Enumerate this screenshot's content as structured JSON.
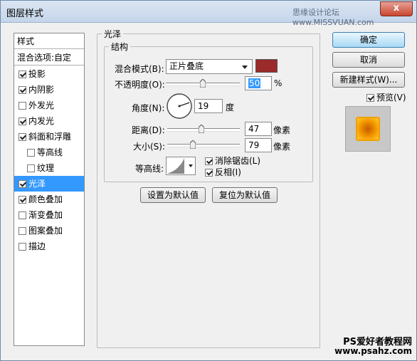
{
  "window": {
    "title": "图层样式",
    "watermark_top": "思缘设计论坛 www.MISSVUAN.com",
    "close_symbol": "x"
  },
  "styles_panel": {
    "header": "样式",
    "blend_options": "混合选项:自定",
    "items": [
      {
        "label": "投影",
        "checked": true
      },
      {
        "label": "内阴影",
        "checked": true
      },
      {
        "label": "外发光",
        "checked": false
      },
      {
        "label": "内发光",
        "checked": true
      },
      {
        "label": "斜面和浮雕",
        "checked": true
      },
      {
        "label": "等高线",
        "checked": false
      },
      {
        "label": "纹理",
        "checked": false
      },
      {
        "label": "光泽",
        "checked": true,
        "selected": true
      },
      {
        "label": "颜色叠加",
        "checked": true
      },
      {
        "label": "渐变叠加",
        "checked": false
      },
      {
        "label": "图案叠加",
        "checked": false
      },
      {
        "label": "描边",
        "checked": false
      }
    ]
  },
  "satin": {
    "group_title": "光泽",
    "structure_title": "结构",
    "blend_mode_label": "混合模式(B):",
    "blend_mode_value": "正片叠底",
    "blend_color": "#9b2a2a",
    "opacity_label": "不透明度(O):",
    "opacity_value": "50",
    "opacity_fraction": 0.5,
    "percent": "%",
    "angle_label": "角度(N):",
    "angle_value": "19",
    "angle_unit": "度",
    "distance_label": "距离(D):",
    "distance_value": "47",
    "distance_unit": "像素",
    "size_label": "大小(S):",
    "size_value": "79",
    "size_unit": "像素",
    "contour_label": "等高线:",
    "anti_alias_label": "消除锯齿(L)",
    "anti_alias_checked": true,
    "invert_label": "反相(I)",
    "invert_checked": true
  },
  "bottom_buttons": {
    "set_default": "设置为默认值",
    "reset_default": "复位为默认值"
  },
  "right_panel": {
    "ok": "确定",
    "cancel": "取消",
    "new_style": "新建样式(W)...",
    "preview_label": "预览(V)",
    "preview_checked": true
  },
  "watermark_bottom": {
    "line1": "PS爱好者教程网",
    "line2": "www.psahz.com"
  }
}
